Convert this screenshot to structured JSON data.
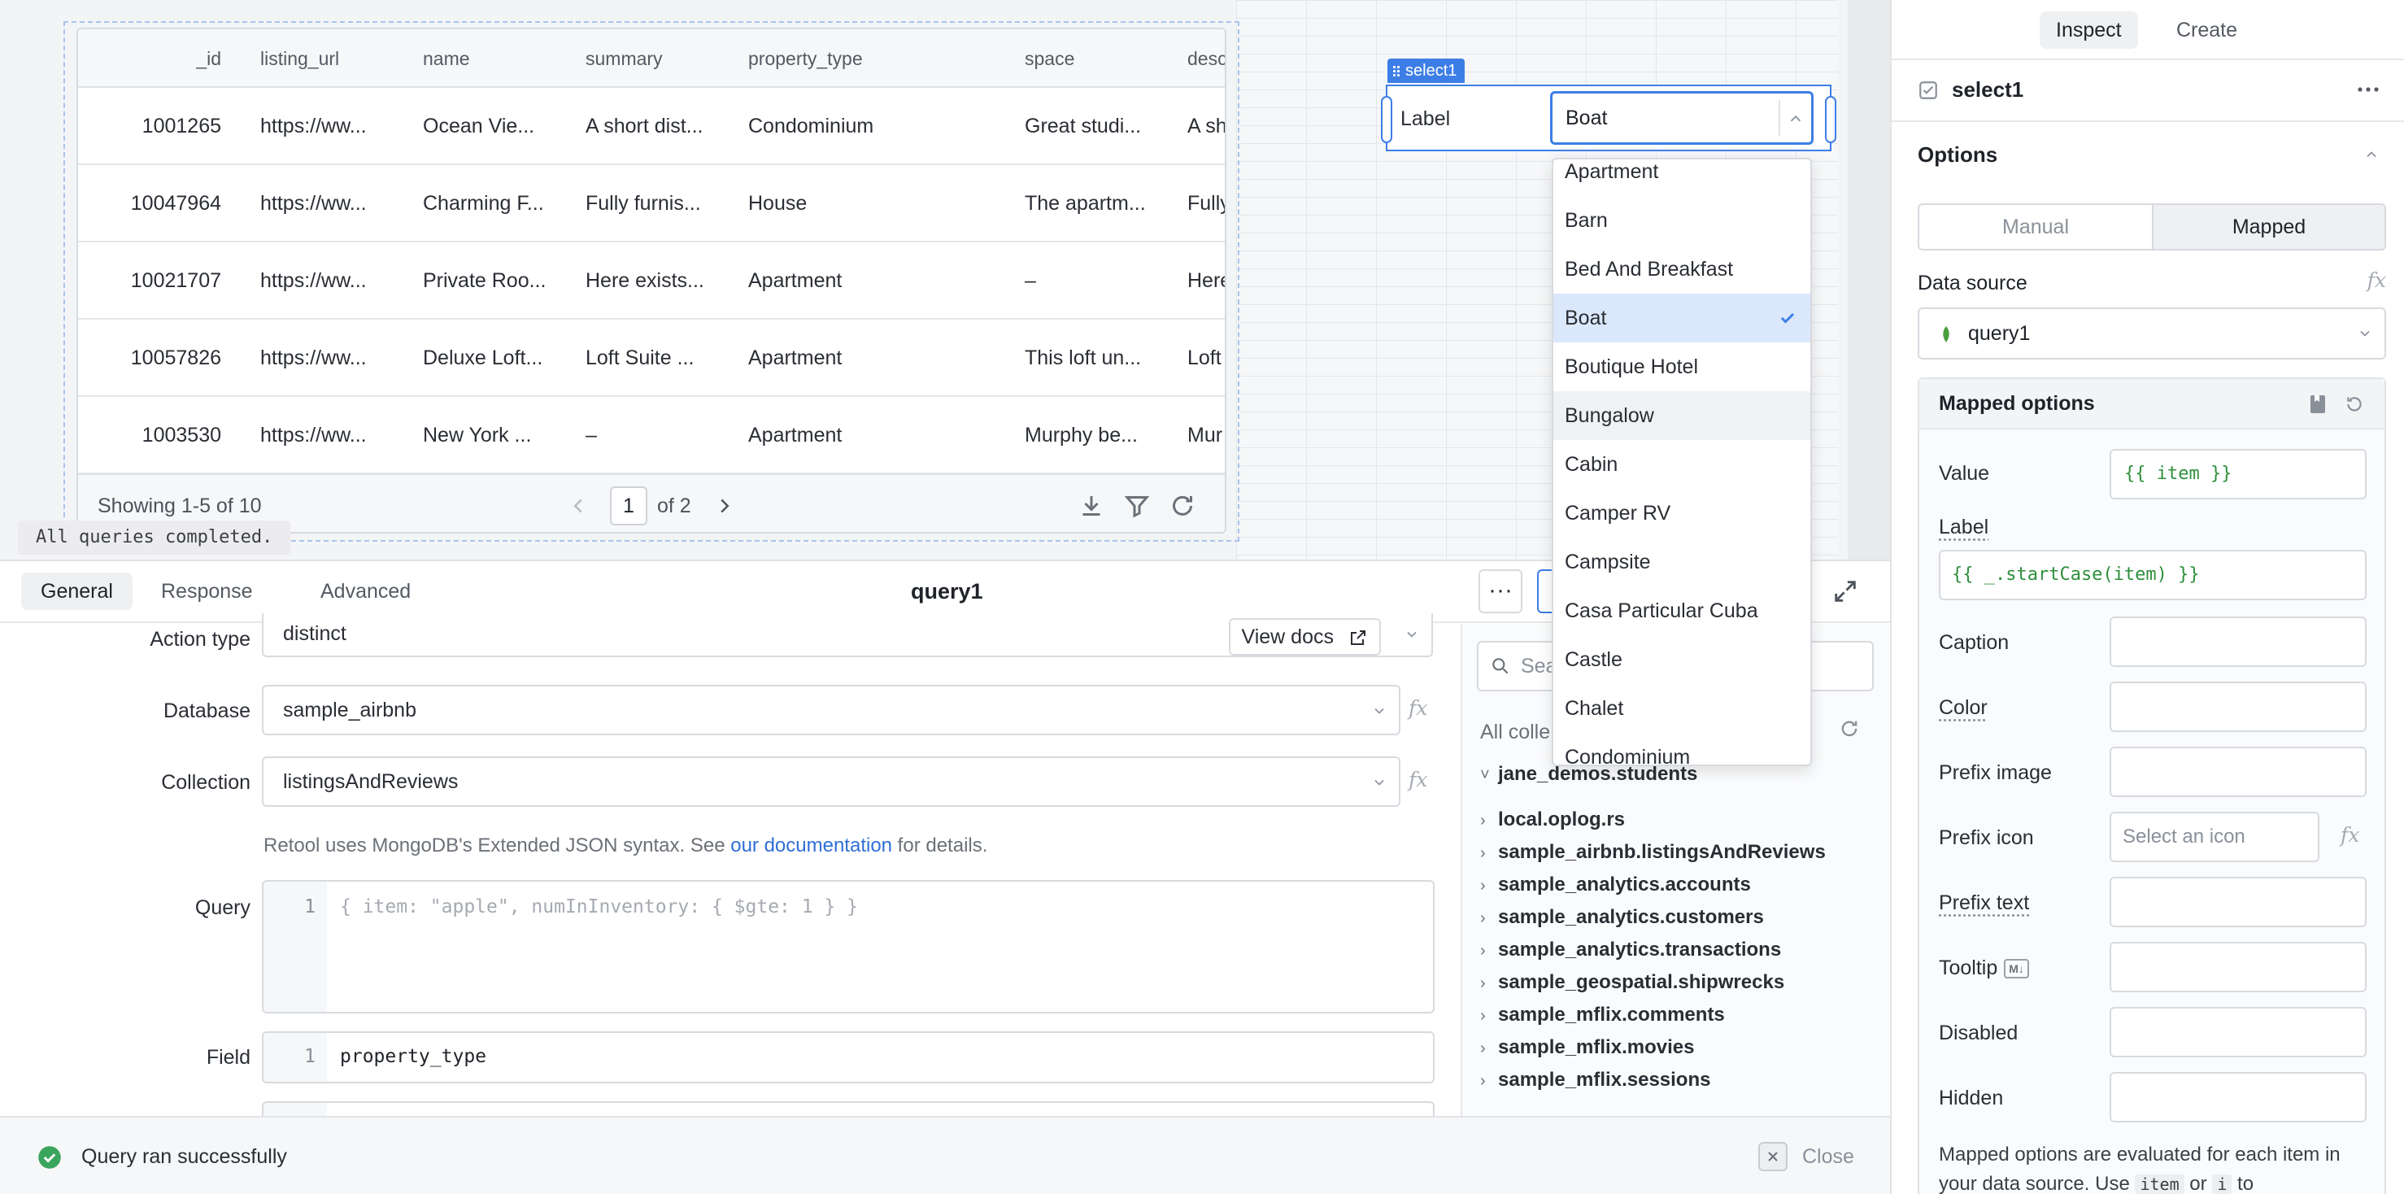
{
  "table": {
    "columns": [
      "_id",
      "listing_url",
      "name",
      "summary",
      "property_type",
      "space",
      "desc"
    ],
    "rows": [
      [
        "1001265",
        "https://ww...",
        "Ocean Vie...",
        "A short dist...",
        "Condominium",
        "Great studi...",
        "A sh"
      ],
      [
        "10047964",
        "https://ww...",
        "Charming F...",
        "Fully furnis...",
        "House",
        "The apartm...",
        "Fully"
      ],
      [
        "10021707",
        "https://ww...",
        "Private Roo...",
        "Here exists...",
        "Apartment",
        "–",
        "Here"
      ],
      [
        "10057826",
        "https://ww...",
        "Deluxe Loft...",
        "Loft Suite ...",
        "Apartment",
        "This loft un...",
        "Loft"
      ],
      [
        "1003530",
        "https://ww...",
        "New York ...",
        "–",
        "Apartment",
        "Murphy be...",
        "Mur"
      ]
    ],
    "showing": "Showing 1-5 of 10",
    "page": "1",
    "of_pages": "of 2"
  },
  "status_note": "All queries completed.",
  "select_widget": {
    "tag": "select1",
    "label": "Label",
    "value": "Boat",
    "options": [
      "Apartment",
      "Barn",
      "Bed And Breakfast",
      "Boat",
      "Boutique Hotel",
      "Bungalow",
      "Cabin",
      "Camper RV",
      "Campsite",
      "Casa Particular Cuba",
      "Castle",
      "Chalet",
      "Condominium"
    ],
    "selected_index": 3,
    "hover_index": 5
  },
  "query_panel": {
    "tabs": [
      "General",
      "Response",
      "Advanced"
    ],
    "active_tab": "General",
    "title": "query1",
    "more_label": "···",
    "action_type_label": "Action type",
    "action_type_value": "distinct",
    "view_docs": "View docs",
    "database_label": "Database",
    "database_value": "sample_airbnb",
    "collection_label": "Collection",
    "collection_value": "listingsAndReviews",
    "fx": "fx",
    "help_prefix": "Retool uses MongoDB's Extended JSON syntax. See ",
    "help_link": "our documentation",
    "help_suffix": " for details.",
    "query_label": "Query",
    "query_line": "1",
    "query_placeholder": "{ item: \"apple\", numInInventory: { $gte: 1 } }",
    "field_label": "Field",
    "field_line": "1",
    "field_value": "property_type"
  },
  "collections": {
    "search_placeholder": "Sea",
    "header": "All colle",
    "items": [
      {
        "name": "jane_demos.students",
        "expanded": true
      },
      {
        "name": "local.oplog.rs",
        "expanded": false
      },
      {
        "name": "sample_airbnb.listingsAndReviews",
        "expanded": false
      },
      {
        "name": "sample_analytics.accounts",
        "expanded": false
      },
      {
        "name": "sample_analytics.customers",
        "expanded": false
      },
      {
        "name": "sample_analytics.transactions",
        "expanded": false
      },
      {
        "name": "sample_geospatial.shipwrecks",
        "expanded": false
      },
      {
        "name": "sample_mflix.comments",
        "expanded": false
      },
      {
        "name": "sample_mflix.movies",
        "expanded": false
      },
      {
        "name": "sample_mflix.sessions",
        "expanded": false
      }
    ]
  },
  "success_bar": {
    "message": "Query ran successfully",
    "close": "Close"
  },
  "inspector": {
    "tabs": [
      "Inspect",
      "Create"
    ],
    "active_tab": "Inspect",
    "component_name": "select1",
    "options_title": "Options",
    "modes": [
      "Manual",
      "Mapped"
    ],
    "active_mode": "Mapped",
    "data_source_label": "Data source",
    "data_source_value": "query1",
    "fx": "fx",
    "mapped_title": "Mapped options",
    "fields": {
      "value_label": "Value",
      "value_code": "{{ item }}",
      "label_label": "Label",
      "label_code": "{{ _.startCase(item) }}",
      "caption_label": "Caption",
      "color_label": "Color",
      "prefix_image_label": "Prefix image",
      "prefix_icon_label": "Prefix icon",
      "prefix_icon_placeholder": "Select an icon",
      "prefix_text_label": "Prefix text",
      "tooltip_label": "Tooltip",
      "tooltip_badge": "M↓",
      "disabled_label": "Disabled",
      "hidden_label": "Hidden"
    },
    "note_prefix": "Mapped options are evaluated for each item in your data source. Use ",
    "note_code1": "item",
    "note_mid": " or ",
    "note_code2": "i",
    "note_suffix": " to"
  },
  "colors": {
    "accent": "#3d7ee6",
    "success": "#3aa55d",
    "code_green": "#2f8f3c",
    "mongo_leaf": "#4a9e3f"
  }
}
